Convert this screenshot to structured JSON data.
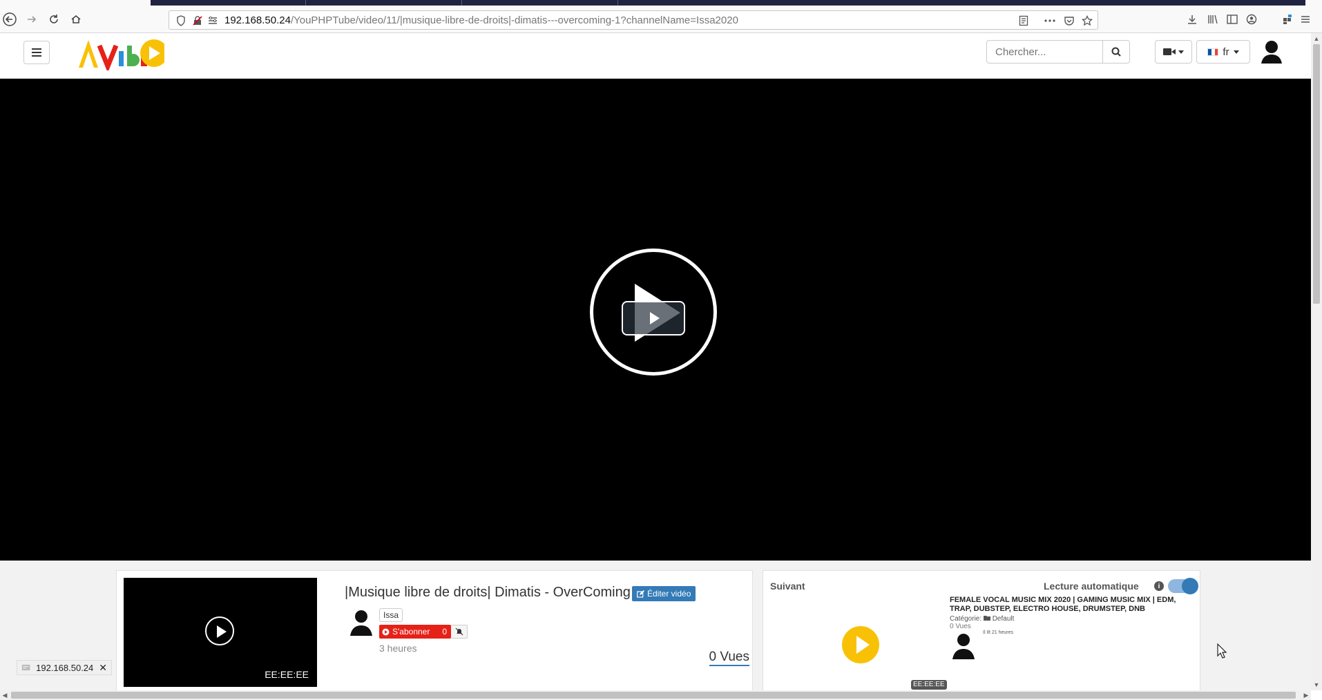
{
  "browser": {
    "url_host": "192.168.50.24",
    "url_path": "/YouPHPTube/video/11/|musique-libre-de-droits|-dimatis---overcoming-1?channelName=Issa2020"
  },
  "site": {
    "search_placeholder": "Chercher...",
    "language": "fr"
  },
  "video": {
    "title": "|Musique libre de droits| Dimatis - OverComing",
    "edit_label": "Éditer vidéo",
    "channel": "Issa",
    "subscribe_label": "S'abonner",
    "subscriber_count": "0",
    "time_ago": "3 heures",
    "views": "0 Vues",
    "duration": "EE:EE:EE"
  },
  "next": {
    "label": "Suivant",
    "autoplay_label": "Lecture automatique",
    "title": "FEMALE VOCAL MUSIC MIX 2020 | GAMING MUSIC MIX | EDM, TRAP, DUBSTEP, ELECTRO HOUSE, DRUMSTEP, DNB",
    "category_label": "Catégorie:",
    "category": "Default",
    "views": "0 Vues",
    "date": "Il Ilt 21 heures",
    "duration": "EE:EE:EE"
  },
  "status": {
    "host": "192.168.50.24"
  },
  "colors": {
    "brand_blue": "#337ab7",
    "subscribe_red": "#e62117",
    "play_yellow": "#f9c106",
    "tab_strip": "#202340"
  }
}
